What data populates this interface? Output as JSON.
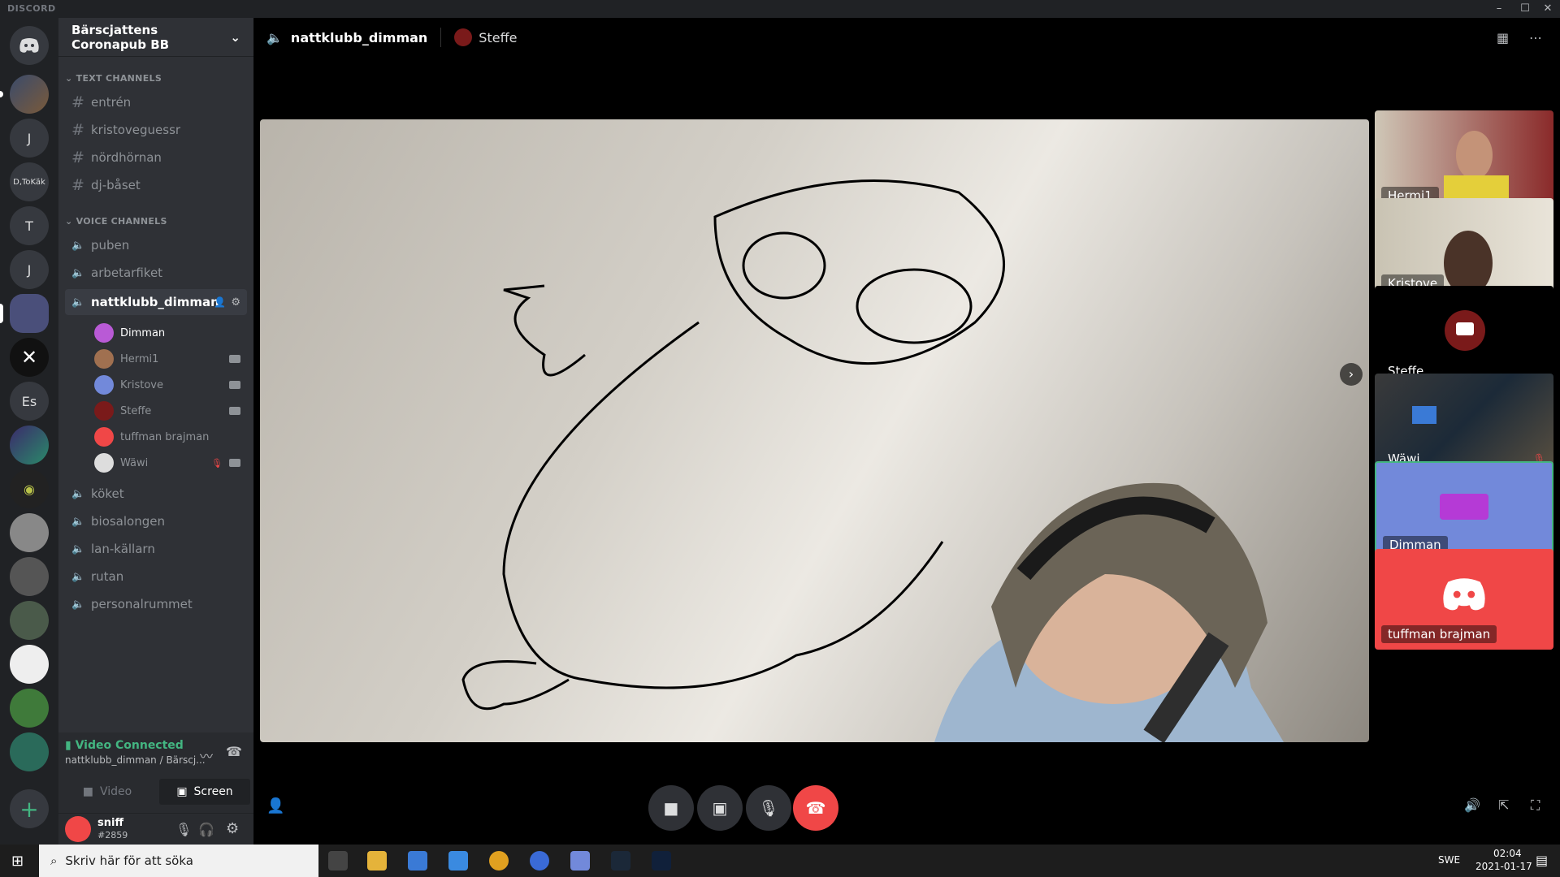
{
  "titlebar": {
    "brand": "DISCORD"
  },
  "rail": {
    "servers": [
      {
        "label": ""
      },
      {
        "label": "J"
      },
      {
        "label": "D,ToKäk"
      },
      {
        "label": "T"
      },
      {
        "label": "J"
      },
      {
        "label": ""
      },
      {
        "label": ""
      },
      {
        "label": "Es"
      }
    ],
    "add_label": "+"
  },
  "sidebar": {
    "guild_name": "Bärscjattens Coronapub BB",
    "text_category": "TEXT CHANNELS",
    "text_channels": [
      "entrén",
      "kristoveguessr",
      "nördhörnan",
      "dj-båset"
    ],
    "voice_category": "VOICE CHANNELS",
    "voice_channels_top": [
      "puben",
      "arbetarfiket"
    ],
    "active_voice": "nattklubb_dimman",
    "voice_users": [
      "Dimman",
      "Hermi1",
      "Kristove",
      "Steffe",
      "tuffman brajman",
      "Wäwi"
    ],
    "voice_channels_bottom": [
      "köket",
      "biosalongen",
      "lan-källarn",
      "rutan",
      "personalrummet"
    ],
    "vc_status": "Video Connected",
    "vc_location": "nattklubb_dimman / Bärscj...",
    "video_btn": "Video",
    "screen_btn": "Screen",
    "username": "sniff",
    "discriminator": "#2859"
  },
  "main": {
    "channel_name": "nattklubb_dimman",
    "streamer": "Steffe",
    "tiles": [
      "Hermi1",
      "Kristove",
      "Steffe",
      "Wäwi",
      "Dimman",
      "tuffman brajman"
    ]
  },
  "taskbar": {
    "search_placeholder": "Skriv här för att söka",
    "lang": "SWE",
    "time": "02:04",
    "date": "2021-01-17"
  },
  "colors": {
    "blurple": "#7289da",
    "green": "#43b581",
    "red": "#f04747"
  }
}
